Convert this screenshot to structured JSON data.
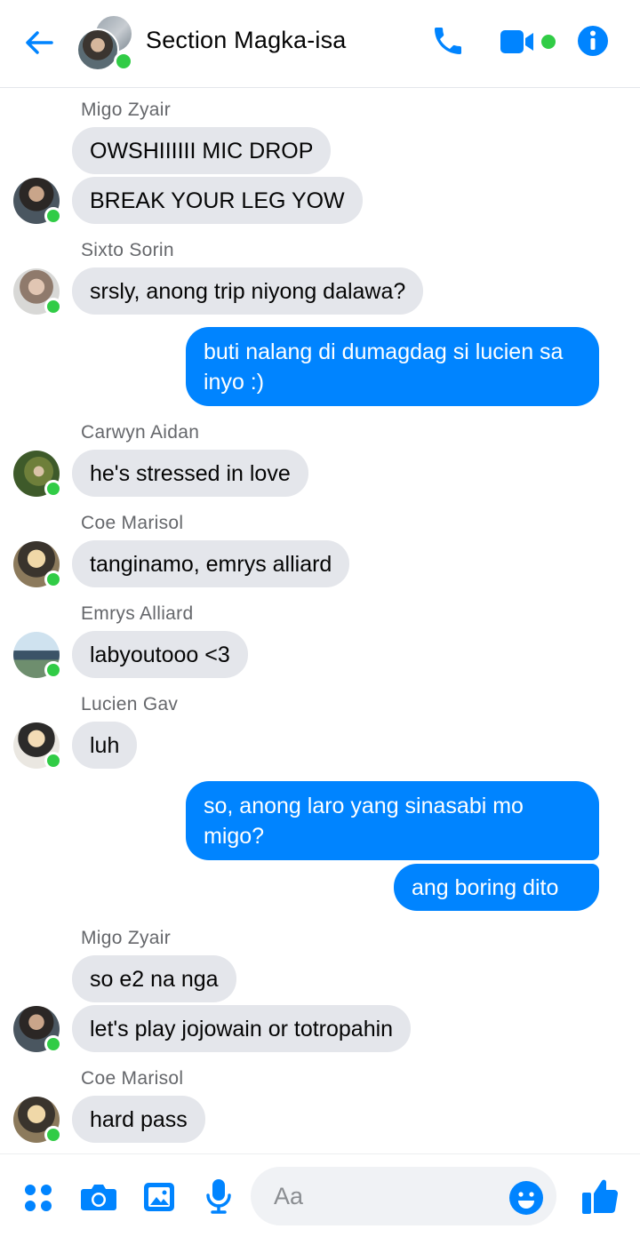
{
  "header": {
    "title": "Section Magka-isa",
    "accent": "#0084ff",
    "online_color": "#31cc46"
  },
  "messages": [
    {
      "sender": "Migo Zyair"
    },
    {
      "text": "OWSHIIIIII MIC DROP"
    },
    {
      "text": "BREAK YOUR LEG YOW"
    },
    {
      "sender": "Sixto Sorin"
    },
    {
      "text": "srsly, anong trip niyong dalawa?"
    },
    {
      "text": "buti nalang di dumagdag si lucien sa inyo :)"
    },
    {
      "sender": "Carwyn Aidan"
    },
    {
      "text": "he's stressed in love"
    },
    {
      "sender": "Coe Marisol"
    },
    {
      "text": "tanginamo, emrys alliard"
    },
    {
      "sender": "Emrys Alliard"
    },
    {
      "text": "labyoutooo <3"
    },
    {
      "sender": "Lucien Gav"
    },
    {
      "text": "luh"
    },
    {
      "text": "so, anong laro yang sinasabi mo migo?"
    },
    {
      "text": "ang boring dito"
    },
    {
      "sender": "Migo Zyair"
    },
    {
      "text": "so e2 na nga"
    },
    {
      "text": "let's play jojowain or totropahin"
    },
    {
      "sender": "Coe Marisol"
    },
    {
      "text": "hard pass"
    }
  ],
  "composer": {
    "placeholder": "Aa"
  }
}
